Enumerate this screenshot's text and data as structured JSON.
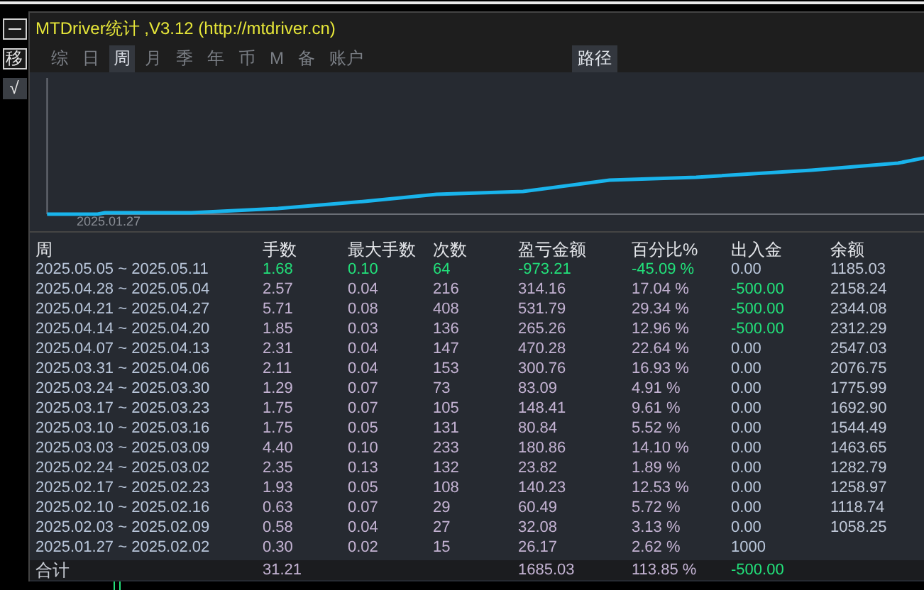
{
  "window": {
    "title": "MTDriver统计 ,V3.12 (http://mtdriver.cn)"
  },
  "side_buttons": [
    {
      "kind": "minimize"
    },
    {
      "kind": "text",
      "label": "移"
    },
    {
      "kind": "text",
      "label": "√"
    }
  ],
  "tabs": [
    {
      "label": "综",
      "selected": false
    },
    {
      "label": "日",
      "selected": false
    },
    {
      "label": "周",
      "selected": true
    },
    {
      "label": "月",
      "selected": false
    },
    {
      "label": "季",
      "selected": false
    },
    {
      "label": "年",
      "selected": false
    },
    {
      "label": "币",
      "selected": false
    },
    {
      "label": "M",
      "selected": false
    },
    {
      "label": "备",
      "selected": false
    },
    {
      "label": "账户",
      "selected": false
    }
  ],
  "path_button": "路径",
  "chart": {
    "start_label": "2025.01.27"
  },
  "table": {
    "columns": [
      "周",
      "手数",
      "最大手数",
      "次数",
      "盈亏金额",
      "百分比%",
      "出入金",
      "余额"
    ],
    "rows": [
      {
        "cells": [
          "2025.05.05 ~ 2025.05.11",
          "1.68",
          "0.10",
          "64",
          "-973.21",
          "-45.09 %",
          "0.00",
          "1185.03"
        ],
        "highlight": true,
        "cash_highlight": false
      },
      {
        "cells": [
          "2025.04.28 ~ 2025.05.04",
          "2.57",
          "0.04",
          "216",
          "314.16",
          "17.04 %",
          "-500.00",
          "2158.24"
        ],
        "highlight": false,
        "cash_highlight": true
      },
      {
        "cells": [
          "2025.04.21 ~ 2025.04.27",
          "5.71",
          "0.08",
          "408",
          "531.79",
          "29.34 %",
          "-500.00",
          "2344.08"
        ],
        "highlight": false,
        "cash_highlight": true
      },
      {
        "cells": [
          "2025.04.14 ~ 2025.04.20",
          "1.85",
          "0.03",
          "136",
          "265.26",
          "12.96 %",
          "-500.00",
          "2312.29"
        ],
        "highlight": false,
        "cash_highlight": true
      },
      {
        "cells": [
          "2025.04.07 ~ 2025.04.13",
          "2.31",
          "0.04",
          "147",
          "470.28",
          "22.64 %",
          "0.00",
          "2547.03"
        ],
        "highlight": false,
        "cash_highlight": false
      },
      {
        "cells": [
          "2025.03.31 ~ 2025.04.06",
          "2.11",
          "0.04",
          "153",
          "300.76",
          "16.93 %",
          "0.00",
          "2076.75"
        ],
        "highlight": false,
        "cash_highlight": false
      },
      {
        "cells": [
          "2025.03.24 ~ 2025.03.30",
          "1.29",
          "0.07",
          "73",
          "83.09",
          "4.91 %",
          "0.00",
          "1775.99"
        ],
        "highlight": false,
        "cash_highlight": false
      },
      {
        "cells": [
          "2025.03.17 ~ 2025.03.23",
          "1.75",
          "0.07",
          "105",
          "148.41",
          "9.61 %",
          "0.00",
          "1692.90"
        ],
        "highlight": false,
        "cash_highlight": false
      },
      {
        "cells": [
          "2025.03.10 ~ 2025.03.16",
          "1.75",
          "0.05",
          "131",
          "80.84",
          "5.52 %",
          "0.00",
          "1544.49"
        ],
        "highlight": false,
        "cash_highlight": false
      },
      {
        "cells": [
          "2025.03.03 ~ 2025.03.09",
          "4.40",
          "0.10",
          "233",
          "180.86",
          "14.10 %",
          "0.00",
          "1463.65"
        ],
        "highlight": false,
        "cash_highlight": false
      },
      {
        "cells": [
          "2025.02.24 ~ 2025.03.02",
          "2.35",
          "0.13",
          "132",
          "23.82",
          "1.89 %",
          "0.00",
          "1282.79"
        ],
        "highlight": false,
        "cash_highlight": false
      },
      {
        "cells": [
          "2025.02.17 ~ 2025.02.23",
          "1.93",
          "0.05",
          "108",
          "140.23",
          "12.53 %",
          "0.00",
          "1258.97"
        ],
        "highlight": false,
        "cash_highlight": false
      },
      {
        "cells": [
          "2025.02.10 ~ 2025.02.16",
          "0.63",
          "0.07",
          "29",
          "60.49",
          "5.72 %",
          "0.00",
          "1118.74"
        ],
        "highlight": false,
        "cash_highlight": false
      },
      {
        "cells": [
          "2025.02.03 ~ 2025.02.09",
          "0.58",
          "0.04",
          "27",
          "32.08",
          "3.13 %",
          "0.00",
          "1058.25"
        ],
        "highlight": false,
        "cash_highlight": false
      },
      {
        "cells": [
          "2025.01.27 ~ 2025.02.02",
          "0.30",
          "0.02",
          "15",
          "26.17",
          "2.62 %",
          "1000"
        ],
        "highlight": false,
        "cash_highlight": false
      }
    ],
    "total": {
      "cells": [
        "合计",
        "31.21",
        "",
        "",
        "1685.03",
        "113.85 %",
        "-500.00"
      ],
      "cash_highlight": true
    }
  }
}
